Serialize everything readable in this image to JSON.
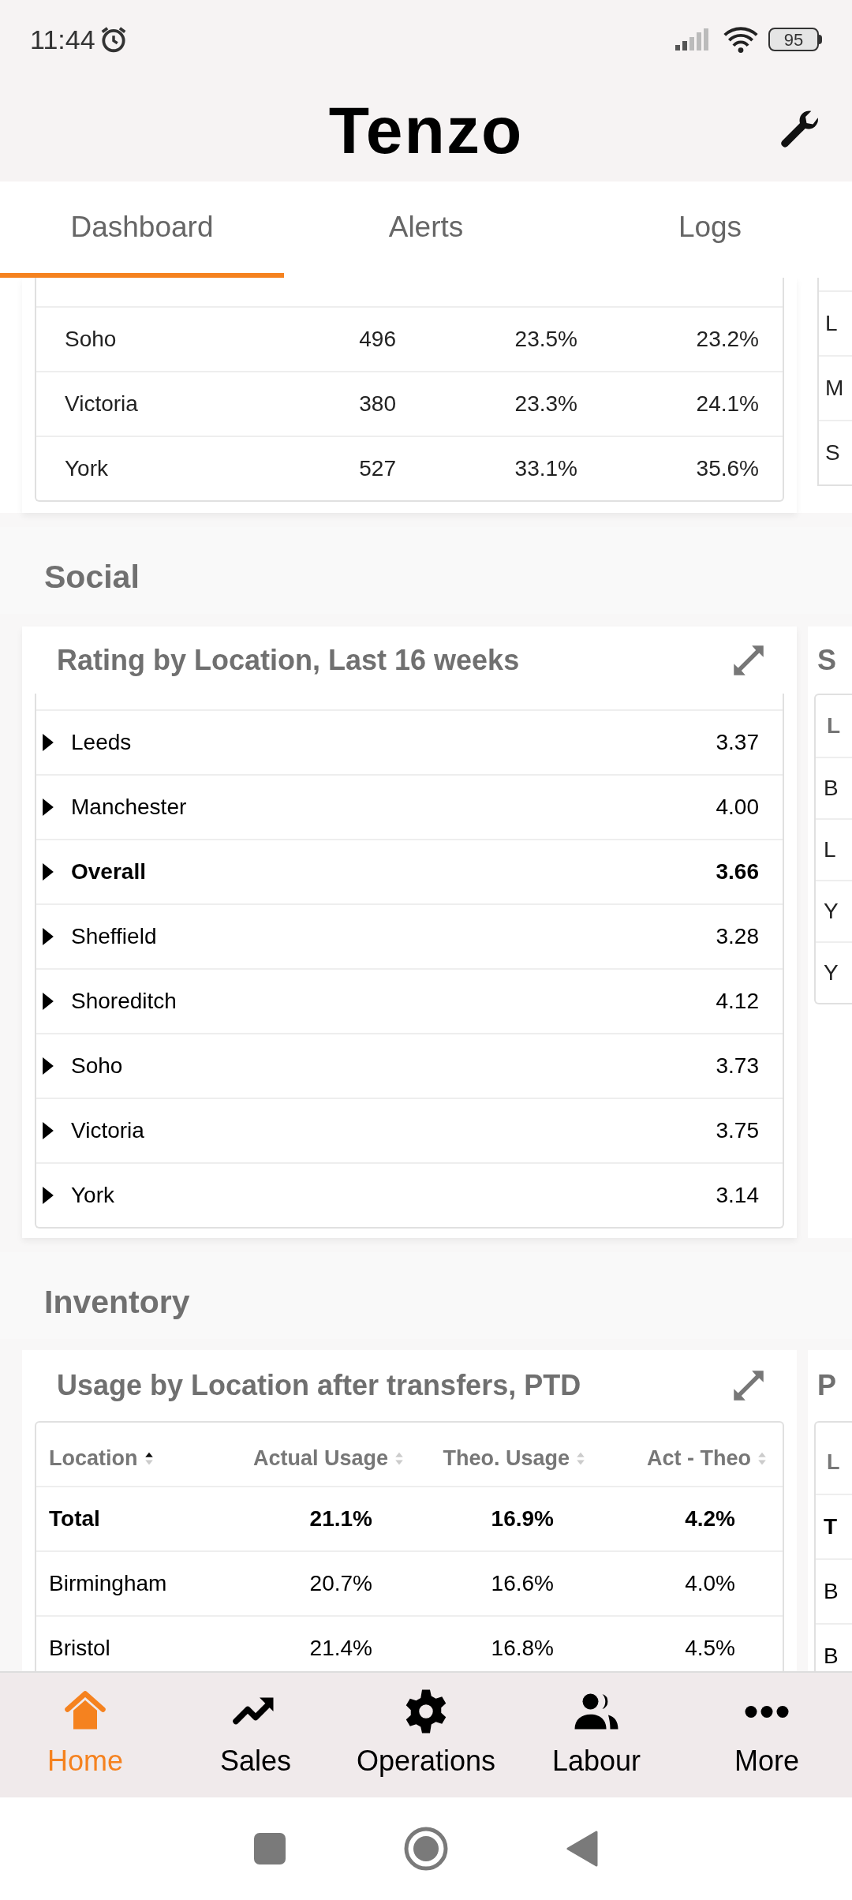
{
  "status_bar": {
    "time": "11:44",
    "battery": "95"
  },
  "header": {
    "logo": "Tenzo"
  },
  "tabs": [
    {
      "label": "Dashboard",
      "selected": true
    },
    {
      "label": "Alerts",
      "selected": false
    },
    {
      "label": "Logs",
      "selected": false
    }
  ],
  "location_table": {
    "rows": [
      [
        "Soho",
        "496",
        "23.5%",
        "23.2%"
      ],
      [
        "Victoria",
        "380",
        "23.3%",
        "24.1%"
      ],
      [
        "York",
        "527",
        "33.1%",
        "35.6%"
      ]
    ],
    "next_card_cells": [
      "L",
      "M",
      "S"
    ]
  },
  "social": {
    "heading": "Social",
    "card": {
      "title": "Rating by Location, Last 16 weeks",
      "rows": [
        {
          "kind": "location",
          "name": "Leeds",
          "value": "3.37"
        },
        {
          "kind": "location",
          "name": "Manchester",
          "value": "4.00"
        },
        {
          "kind": "summary",
          "name": "Overall",
          "value": "3.66"
        },
        {
          "kind": "location",
          "name": "Sheffield",
          "value": "3.28"
        },
        {
          "kind": "location",
          "name": "Shoreditch",
          "value": "4.12"
        },
        {
          "kind": "location",
          "name": "Soho",
          "value": "3.73"
        },
        {
          "kind": "location",
          "name": "Victoria",
          "value": "3.75"
        },
        {
          "kind": "location",
          "name": "York",
          "value": "3.14"
        }
      ]
    },
    "next_card": {
      "title": "S",
      "header": "L",
      "cells": [
        "B",
        "L",
        "Y",
        "Y"
      ]
    }
  },
  "inventory": {
    "heading": "Inventory",
    "card": {
      "title": "Usage by Location after transfers, PTD",
      "columns": [
        {
          "label": "Location",
          "sorted_ascending": true
        },
        {
          "label": "Actual Usage",
          "sorted_ascending": false
        },
        {
          "label": "Theo. Usage",
          "sorted_ascending": false
        },
        {
          "label": "Act - Theo",
          "sorted_ascending": false
        }
      ],
      "rows": [
        {
          "kind": "summary",
          "cells": [
            "Total",
            "21.1%",
            "16.9%",
            "4.2%"
          ]
        },
        {
          "kind": "location",
          "cells": [
            "Birmingham",
            "20.7%",
            "16.6%",
            "4.0%"
          ]
        },
        {
          "kind": "location",
          "cells": [
            "Bristol",
            "21.4%",
            "16.8%",
            "4.5%"
          ]
        }
      ]
    },
    "next_card": {
      "title": "P",
      "header": "L",
      "cells": [
        {
          "kind": "summary",
          "text": "T"
        },
        {
          "kind": "location",
          "text": "B"
        },
        {
          "kind": "location",
          "text": "B"
        }
      ]
    }
  },
  "bottom_nav": [
    {
      "label": "Home",
      "selected": true
    },
    {
      "label": "Sales",
      "selected": false
    },
    {
      "label": "Operations",
      "selected": false
    },
    {
      "label": "Labour",
      "selected": false
    },
    {
      "label": "More",
      "selected": false
    }
  ]
}
